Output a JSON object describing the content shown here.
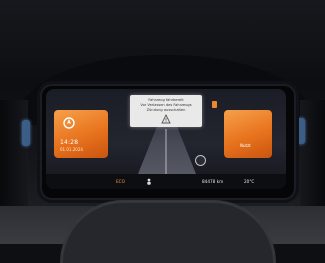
{
  "cluster": {
    "left_card": {
      "icon": "navigation-icon",
      "time": "14:28",
      "date": "01.01.2024"
    },
    "right_card": {
      "label": "Nutzt"
    },
    "warning": {
      "line1": "Fahrzeug fahrbereit",
      "line2": "Vor Verlassen des Fahrzeugs",
      "line3": "Zündung ausschalten",
      "icon": "warning-icon"
    },
    "status_bar": {
      "range": "ECO",
      "odometer": "84478 km",
      "temperature": "20°C"
    }
  },
  "colors": {
    "accent": "#e8731e",
    "screen": "#1b1d26",
    "status_blue": "#3c5e86"
  }
}
